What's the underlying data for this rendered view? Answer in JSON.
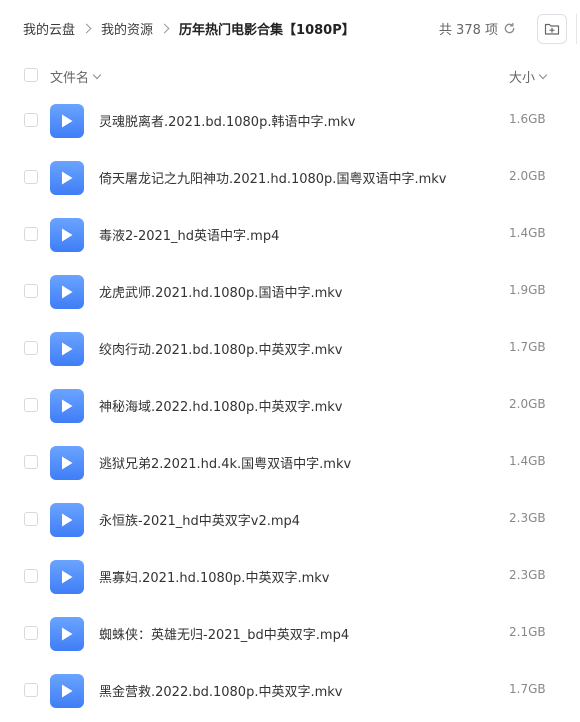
{
  "breadcrumb": {
    "items": [
      "我的云盘",
      "我的资源"
    ],
    "current": "历年热门电影合集【1080P】"
  },
  "summary": {
    "count_text": "共 378 项"
  },
  "columns": {
    "name": "文件名",
    "size": "大小"
  },
  "colors": {
    "icon_blue": "#4a88f8",
    "text": "#333333",
    "muted": "#888888"
  },
  "files": [
    {
      "name": "灵魂脱离者.2021.bd.1080p.韩语中字.mkv",
      "size": "1.6GB"
    },
    {
      "name": "倚天屠龙记之九阳神功.2021.hd.1080p.国粤双语中字.mkv",
      "size": "2.0GB"
    },
    {
      "name": "毒液2-2021_hd英语中字.mp4",
      "size": "1.4GB"
    },
    {
      "name": "龙虎武师.2021.hd.1080p.国语中字.mkv",
      "size": "1.9GB"
    },
    {
      "name": "绞肉行动.2021.bd.1080p.中英双字.mkv",
      "size": "1.7GB"
    },
    {
      "name": "神秘海域.2022.hd.1080p.中英双字.mkv",
      "size": "2.0GB"
    },
    {
      "name": "逃狱兄弟2.2021.hd.4k.国粤双语中字.mkv",
      "size": "1.4GB"
    },
    {
      "name": "永恒族-2021_hd中英双字v2.mp4",
      "size": "2.3GB"
    },
    {
      "name": "黑寡妇.2021.hd.1080p.中英双字.mkv",
      "size": "2.3GB"
    },
    {
      "name": "蜘蛛侠：英雄无归-2021_bd中英双字.mp4",
      "size": "2.1GB"
    },
    {
      "name": "黑金营救.2022.bd.1080p.中英双字.mkv",
      "size": "1.7GB"
    }
  ]
}
